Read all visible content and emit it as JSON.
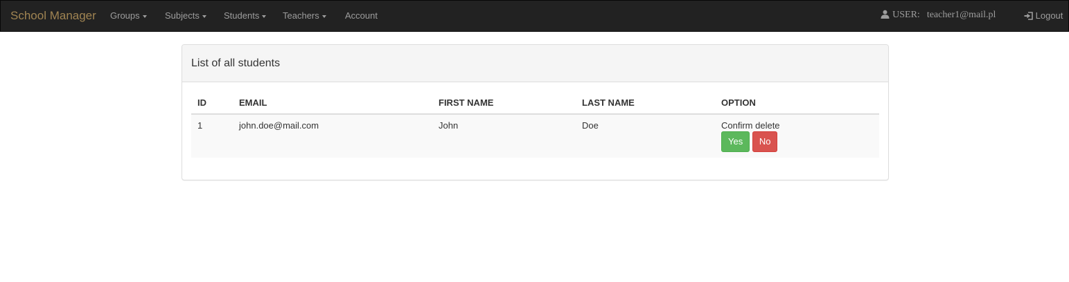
{
  "navbar": {
    "brand": "School Manager",
    "items": [
      {
        "label": "Groups",
        "dropdown": true
      },
      {
        "label": "Subjects",
        "dropdown": true
      },
      {
        "label": "Students",
        "dropdown": true
      },
      {
        "label": "Teachers",
        "dropdown": true
      },
      {
        "label": "Account",
        "dropdown": false
      }
    ],
    "user_label": "USER:",
    "user_email": "teacher1@mail.pl",
    "logout_label": "Logout",
    "colors": {
      "background": "#222222",
      "brand": "#a08452",
      "text": "#9d9d9d"
    }
  },
  "panel": {
    "title": "List of all students",
    "table": {
      "headers": [
        "ID",
        "EMAIL",
        "FIRST NAME",
        "LAST NAME",
        "OPTION"
      ],
      "rows": [
        {
          "id": "1",
          "email": "john.doe@mail.com",
          "first_name": "John",
          "last_name": "Doe",
          "option_text": "Confirm delete",
          "yes_label": "Yes",
          "no_label": "No"
        }
      ]
    }
  },
  "icons": {
    "user": "user-icon",
    "logout": "logout-icon"
  },
  "colors": {
    "yes_button": "#5cb85c",
    "no_button": "#d9534f"
  }
}
